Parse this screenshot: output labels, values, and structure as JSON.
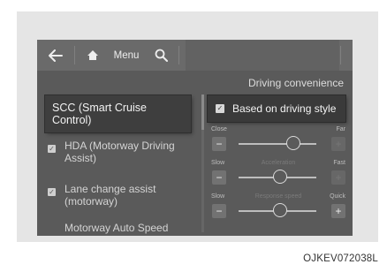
{
  "topbar": {
    "back_icon": "back-arrow-icon",
    "home_icon": "home-icon",
    "menu_label": "Menu",
    "search_icon": "search-icon"
  },
  "screen_title": "Driving convenience",
  "left_menu": {
    "items": [
      {
        "label": "SCC (Smart Cruise Control)",
        "selected": true,
        "checked": null
      },
      {
        "label": "HDA (Motorway Driving Assist)",
        "selected": false,
        "checked": true
      },
      {
        "label": "Lane change assist (motorway)",
        "selected": false,
        "checked": true
      },
      {
        "label": "Motorway Auto Speed",
        "selected": false,
        "checked": false
      }
    ]
  },
  "right_panel": {
    "option": {
      "label": "Based on driving style",
      "checked": true
    },
    "sliders": [
      {
        "left_label": "Close",
        "center_label": "",
        "right_label": "Far",
        "level": 0.7,
        "minus": "−",
        "plus": "+",
        "plus_enabled": false
      },
      {
        "left_label": "Slow",
        "center_label": "Acceleration",
        "right_label": "Fast",
        "level": 0.53,
        "minus": "−",
        "plus": "+",
        "plus_enabled": false
      },
      {
        "left_label": "Slow",
        "center_label": "Response speed",
        "right_label": "Quick",
        "level": 0.53,
        "minus": "−",
        "plus": "+",
        "plus_enabled": true
      }
    ]
  },
  "caption": "OJKEV072038L"
}
